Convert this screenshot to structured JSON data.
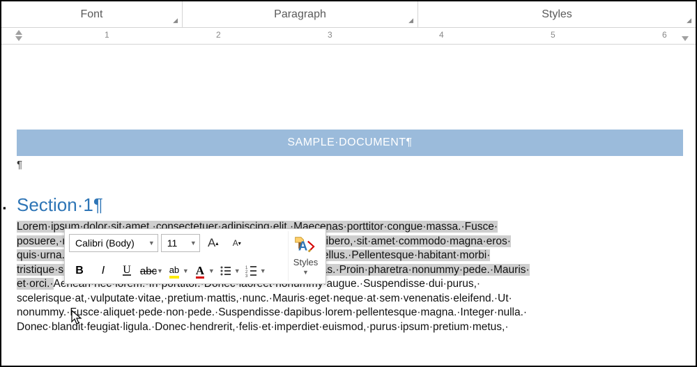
{
  "ribbon": {
    "font_label": "Font",
    "para_label": "Paragraph",
    "styles_label": "Styles"
  },
  "ruler": {
    "ticks": [
      "1",
      "2",
      "3",
      "4",
      "5",
      "6"
    ]
  },
  "document": {
    "title": "SAMPLE·DOCUMENT¶",
    "empty_pilcrow": "¶",
    "heading": "Section·1¶",
    "body_selected": "Lorem·ipsum·dolor·sit·amet,·consectetuer·adipiscing·elit.·Maecenas·porttitor·congue·massa.·Fusce· posuere,·magna·sed·pulvinar·ultricies,·purus·lectus·malesuada·libero,·sit·amet·commodo·magna·eros· quis·urna.·Nunc·viverra·imperdiet·enim.·Fusce·est.·Vivamus·a·tellus.·Pellentesque·habitant·morbi· tristique·senectus·et·netus·et·malesuada·fames·ac·turpis·egestas.·Proin·pharetra·nonummy·pede.·Mauris· et·orci.·",
    "body_rest": "Aenean·nec·lorem.·In·porttitor.·Donec·laoreet·nonummy·augue.·Suspendisse·dui·purus,· scelerisque·at,·vulputate·vitae,·pretium·mattis,·nunc.·Mauris·eget·neque·at·sem·venenatis·eleifend.·Ut· nonummy.·Fusce·aliquet·pede·non·pede.·Suspendisse·dapibus·lorem·pellentesque·magna.·Integer·nulla.· Donec·blandit·feugiat·ligula.·Donec·hendrerit,·felis·et·imperdiet·euismod,·purus·ipsum·pretium·metus,·"
  },
  "mini": {
    "font_name": "Calibri (Body)",
    "font_size": "11",
    "bold": "B",
    "italic": "I",
    "underline": "U",
    "grow": "A",
    "shrink": "A",
    "styles_label": "Styles",
    "highlight": "ab",
    "fontcolor": "A",
    "strikeA": "abc"
  }
}
